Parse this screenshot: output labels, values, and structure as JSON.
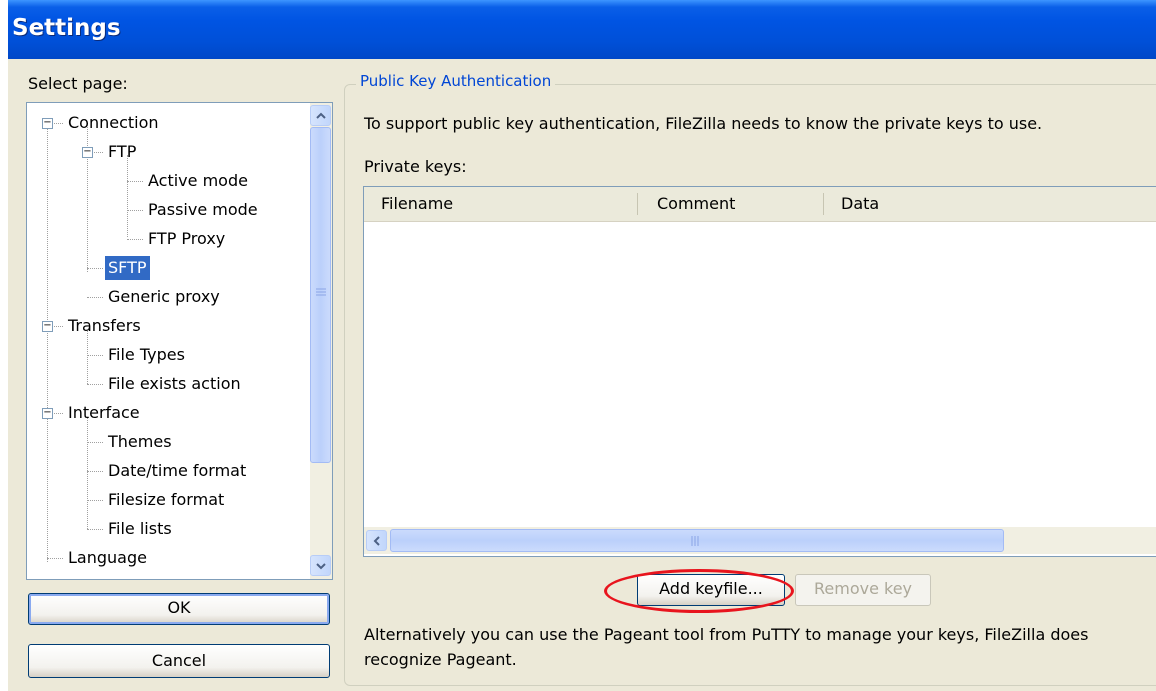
{
  "window": {
    "title": "Settings"
  },
  "left": {
    "select_page_label": "Select page:",
    "tree": [
      {
        "label": "Connection"
      },
      {
        "label": "FTP"
      },
      {
        "label": "Active mode"
      },
      {
        "label": "Passive mode"
      },
      {
        "label": "FTP Proxy"
      },
      {
        "label": "SFTP",
        "selected": true
      },
      {
        "label": "Generic proxy"
      },
      {
        "label": "Transfers"
      },
      {
        "label": "File Types"
      },
      {
        "label": "File exists action"
      },
      {
        "label": "Interface"
      },
      {
        "label": "Themes"
      },
      {
        "label": "Date/time format"
      },
      {
        "label": "Filesize format"
      },
      {
        "label": "File lists"
      },
      {
        "label": "Language"
      }
    ],
    "ok_label": "OK",
    "cancel_label": "Cancel"
  },
  "panel": {
    "group_title": "Public Key Authentication",
    "description": "To support public key authentication, FileZilla needs to know the private keys to use.",
    "private_keys_label": "Private keys:",
    "columns": [
      "Filename",
      "Comment",
      "Data"
    ],
    "add_keyfile_label": "Add keyfile...",
    "remove_key_label": "Remove key",
    "footer_line1": "Alternatively you can use the Pageant tool from PuTTY to manage your keys, FileZilla does",
    "footer_line2": "recognize Pageant."
  },
  "colors": {
    "title_bar": "#0054e3",
    "selection": "#316ac5",
    "group_title": "#0046d5",
    "highlight_ring": "#e8141d"
  }
}
